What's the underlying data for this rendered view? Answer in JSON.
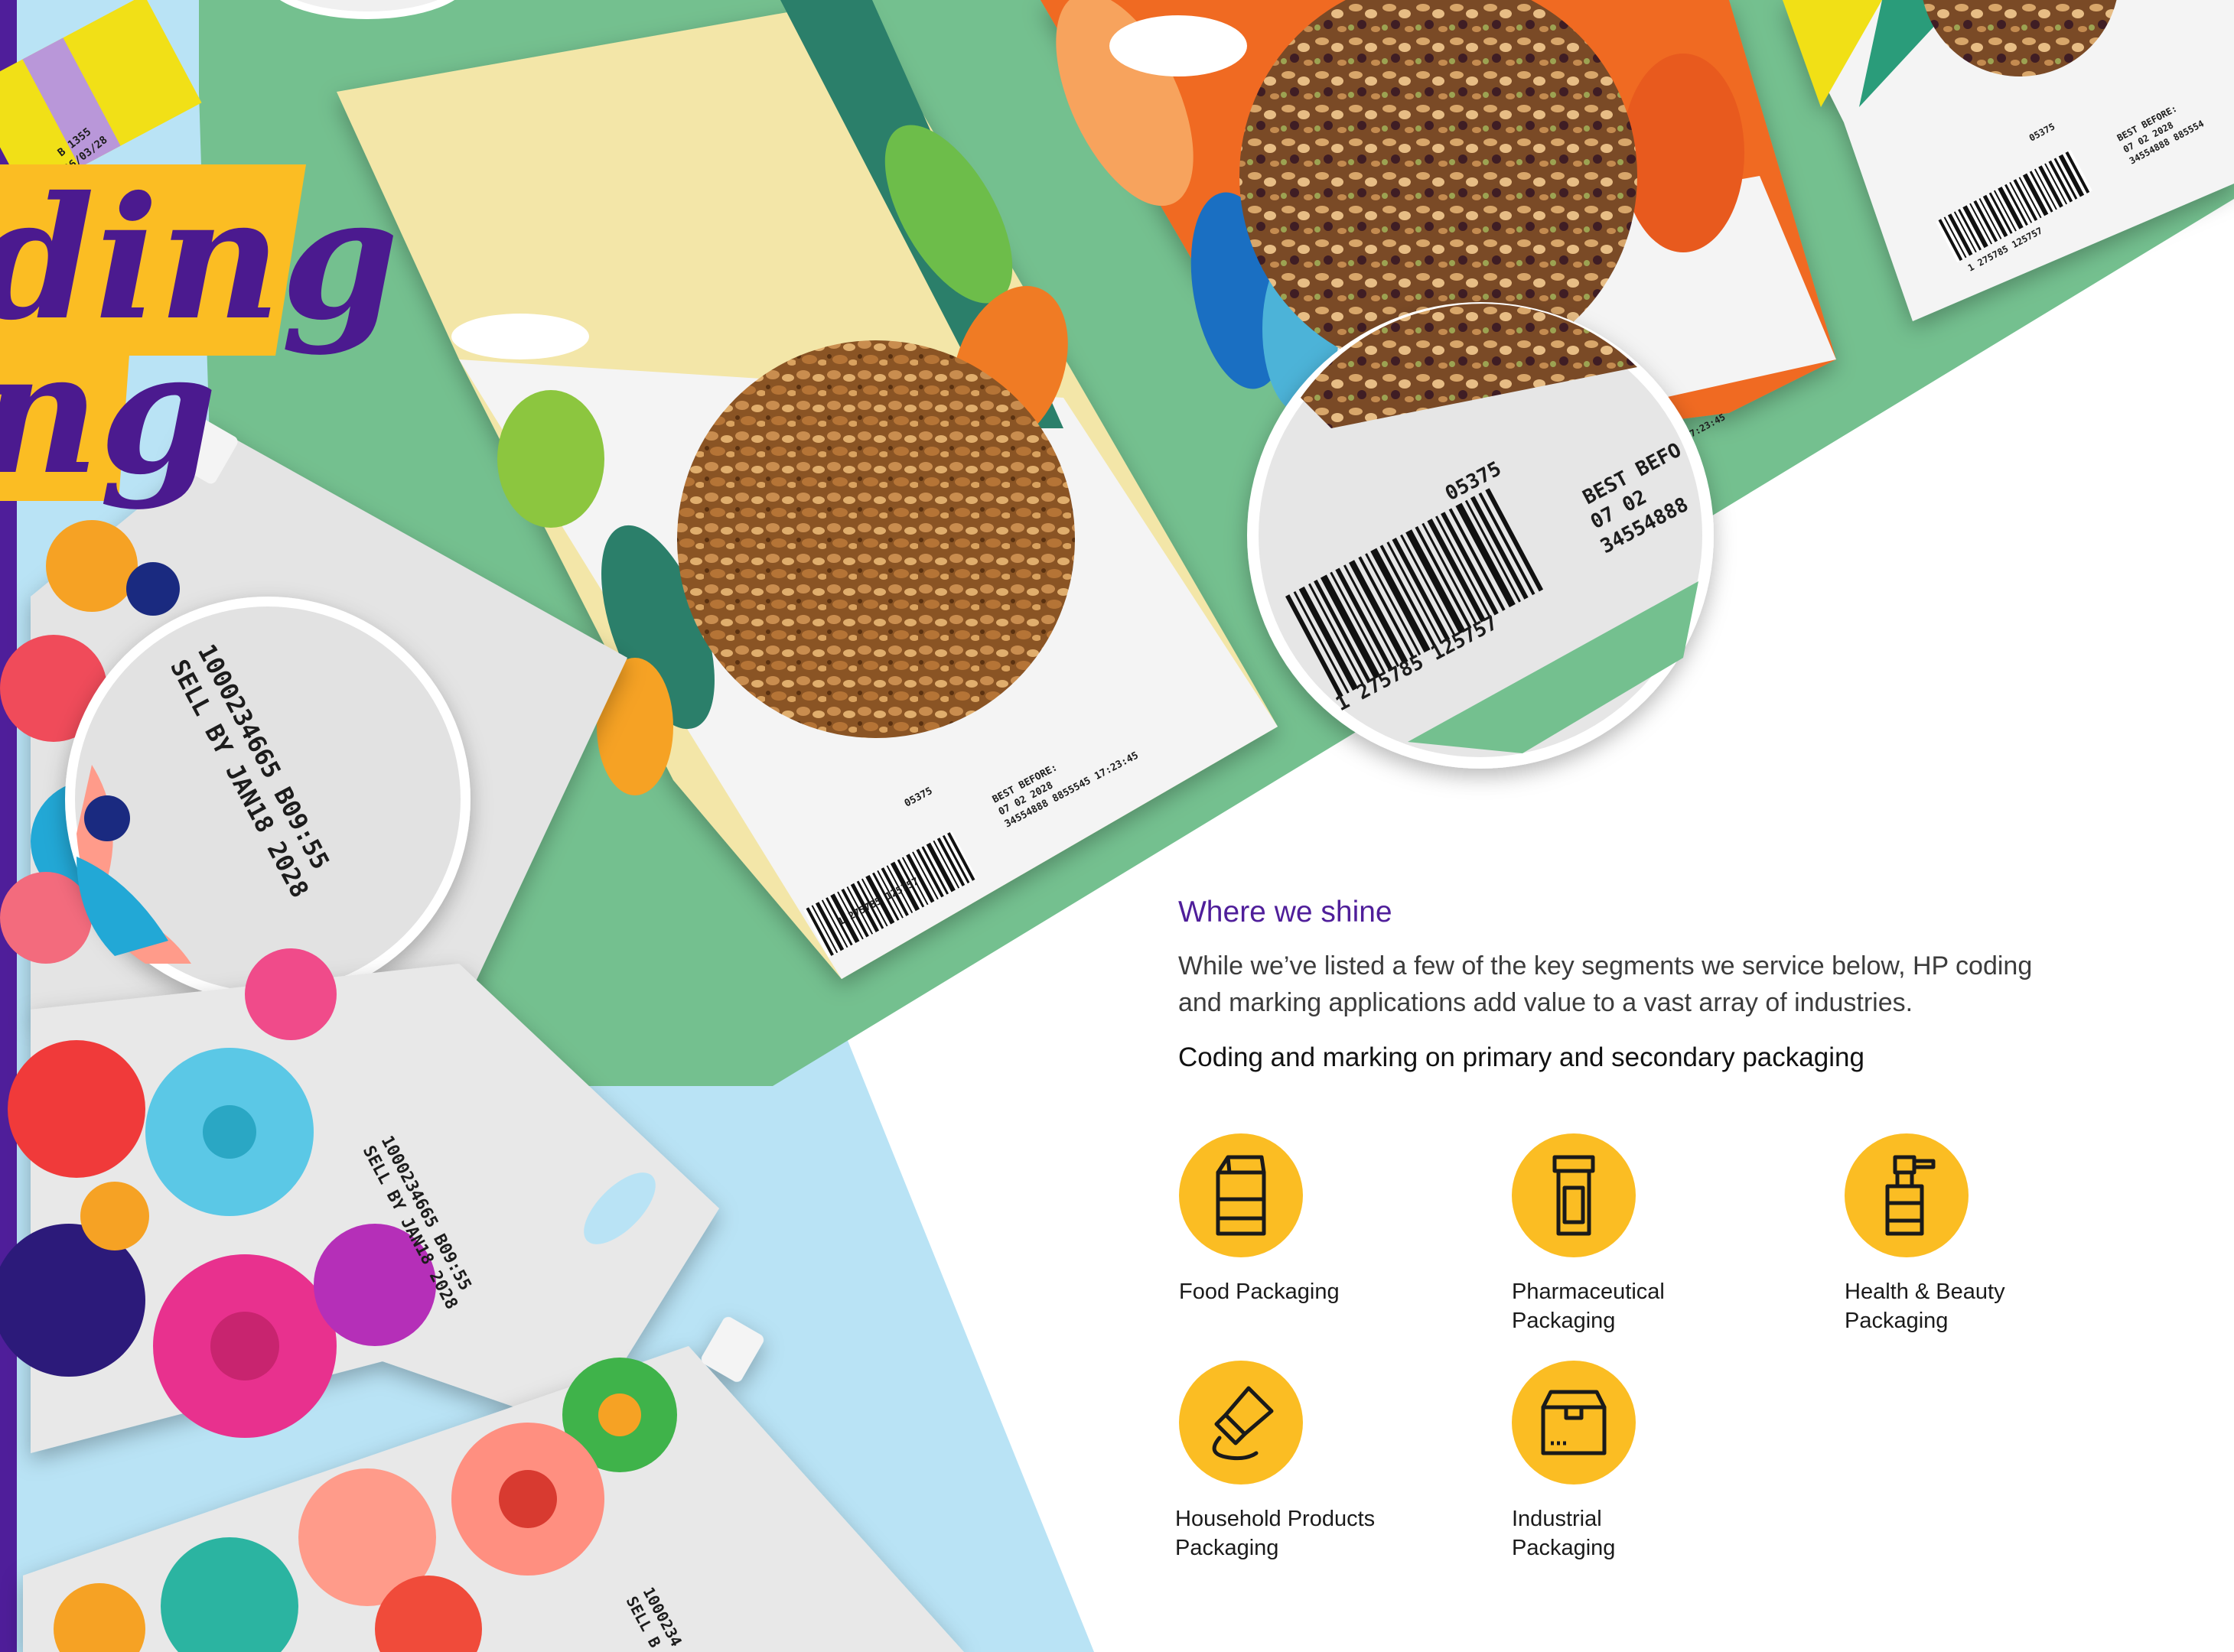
{
  "colors": {
    "brand_purple": "#4f1e9a",
    "accent_yellow": "#fbbd23",
    "sky_blue": "#b9e3f5",
    "mint_green": "#74c08f"
  },
  "title_fragments": {
    "line1": "ding",
    "line2": "ng"
  },
  "package_codes": {
    "pouch_code_line1": "1000234665 B09:55",
    "pouch_code_line2": "SELL BY JAN18 2028",
    "pouch2_line1": "1000234665 B09:55",
    "pouch2_line2": "SELL BY JAN18 2028",
    "pouch3_line1": "1000234",
    "pouch3_line2": "SELL B",
    "bag_barcode_top": "05375",
    "bag_barcode_bottom": "1 275785 125757",
    "bag_best_before": "BEST BEFORE:",
    "bag_date": "07 02 2028",
    "bag_lot": "34554888 8855545 17:23:45",
    "zoom_barcode_top": "05375",
    "zoom_barcode_bottom": "1 275785 125757",
    "zoom_best": "BEST BEFO",
    "zoom_date": "07 02",
    "zoom_lot": "34554888",
    "bag2_time": "17:23:45",
    "bag3_barcode_top": "05375",
    "bag3_barcode_bottom": "1 275785 125757",
    "bag3_best_before": "BEST BEFORE:",
    "bag3_date": "07 02 2028",
    "bag3_lot": "34554888 885554",
    "yellow_pack_line1": "B 1355",
    "yellow_pack_line2": "06/03/28"
  },
  "content": {
    "section_title": "Where we shine",
    "intro": "While we’ve listed a few of the key segments we service below, HP coding and marking applications add value to a vast array of industries.",
    "subhead": "Coding and marking on primary and secondary packaging"
  },
  "segments": [
    {
      "icon": "food-bag-icon",
      "line1": "Food Packaging",
      "line2": ""
    },
    {
      "icon": "pill-bottle-icon",
      "line1": "Pharmaceutical",
      "line2": "Packaging"
    },
    {
      "icon": "spray-bottle-icon",
      "line1": "Health & Beauty",
      "line2": "Packaging"
    },
    {
      "icon": "tube-icon",
      "line1": "Household Products",
      "line2": "Packaging"
    },
    {
      "icon": "box-icon",
      "line1": "Industrial",
      "line2": "Packaging"
    }
  ]
}
